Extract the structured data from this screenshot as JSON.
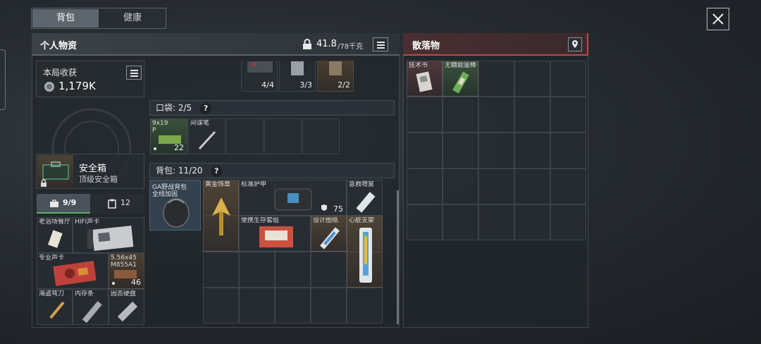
{
  "tabs": [
    {
      "label": "背包",
      "active": true
    },
    {
      "label": "健康",
      "active": false
    }
  ],
  "personal": {
    "title": "个人物资",
    "weight_value": "41.8",
    "weight_max": "/78千克"
  },
  "loot_panel": {
    "title": "散落物"
  },
  "harvest": {
    "label": "本局收获",
    "value": "1,179K"
  },
  "safe_box": {
    "name": "安全箱",
    "subtitle": "顶级安全箱"
  },
  "sub_tabs": [
    {
      "label": "9/9",
      "icon": "briefcase-icon",
      "active": true
    },
    {
      "label": "12",
      "icon": "clipboard-icon",
      "active": false
    }
  ],
  "top_row": [
    {
      "label": "",
      "count": "4/4"
    },
    {
      "label": "",
      "count": "3/3"
    },
    {
      "label": "",
      "count": "2/2"
    }
  ],
  "pocket": {
    "label": "口袋:",
    "count": "2/5",
    "items": [
      {
        "label": "9x19 P",
        "count": "22"
      },
      {
        "label": "间谍笔",
        "count": ""
      }
    ]
  },
  "backpack": {
    "label": "背包:",
    "count": "11/20",
    "bag_label": "GA野战背包",
    "bag_sublabel": "全线加固",
    "items": [
      {
        "label": "黄金饰章",
        "count": ""
      },
      {
        "label": "标准护甲",
        "count": "75"
      },
      {
        "label": "急救喷雾",
        "count": ""
      },
      {
        "label": "便携生存套组",
        "count": ""
      },
      {
        "label": "设计图纸",
        "count": ""
      },
      {
        "label": "心脏支架",
        "count": ""
      }
    ]
  },
  "safe_items": [
    {
      "label": "老浴场餐厅",
      "count": ""
    },
    {
      "label": "HIFI声卡",
      "count": ""
    },
    {
      "label": "专业声卡",
      "count": ""
    },
    {
      "label": "5.56x45 M855A1",
      "count": "46"
    },
    {
      "label": "海盗弯刀",
      "count": ""
    },
    {
      "label": "内存条",
      "count": ""
    },
    {
      "label": "固态硬盘",
      "count": ""
    }
  ],
  "loot_items": [
    {
      "label": "技术书"
    },
    {
      "label": "无糖能量棒"
    }
  ],
  "colors": {
    "accent_red": "#c0484c",
    "rarity_green": "#5f8a4e",
    "rarity_red": "#8a4f4f",
    "rarity_gold": "#8a6a45"
  }
}
